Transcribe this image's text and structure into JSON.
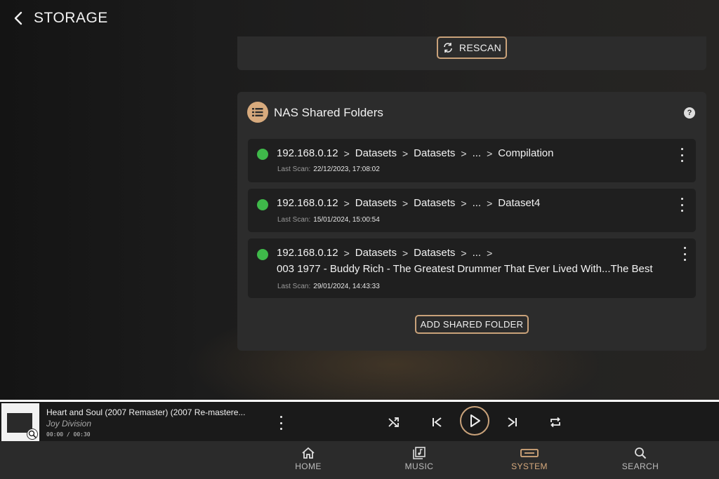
{
  "header": {
    "title": "STORAGE"
  },
  "rescan": {
    "label": "RESCAN"
  },
  "nas": {
    "title": "NAS Shared Folders",
    "help": "?",
    "folders": [
      {
        "ip": "192.168.0.12",
        "seg1": "Datasets",
        "seg2": "Datasets",
        "ellipsis": "...",
        "leaf": "Compilation",
        "scan_label": "Last Scan:",
        "scan_time": "22/12/2023, 17:08:02",
        "status": "online"
      },
      {
        "ip": "192.168.0.12",
        "seg1": "Datasets",
        "seg2": "Datasets",
        "ellipsis": "...",
        "leaf": "Dataset4",
        "scan_label": "Last Scan:",
        "scan_time": "15/01/2024, 15:00:54",
        "status": "online"
      },
      {
        "ip": "192.168.0.12",
        "seg1": "Datasets",
        "seg2": "Datasets",
        "ellipsis": "...",
        "leaf": "003 1977 - Buddy Rich - The Greatest Drummer That Ever Lived With...The Best",
        "scan_label": "Last Scan:",
        "scan_time": "29/01/2024, 14:43:33",
        "status": "online"
      }
    ],
    "add_label": "ADD SHARED FOLDER"
  },
  "player": {
    "title": "Heart and Soul (2007 Remaster) (2007 Re-mastere...",
    "artist": "Joy Division",
    "time": "00:00 / 00:30"
  },
  "nav": {
    "items": [
      {
        "label": "HOME",
        "icon": "home-icon"
      },
      {
        "label": "MUSIC",
        "icon": "music-library-icon"
      },
      {
        "label": "SYSTEM",
        "icon": "system-icon",
        "active": true
      },
      {
        "label": "SEARCH",
        "icon": "search-icon"
      }
    ]
  },
  "colors": {
    "accent": "#d7aa7d",
    "status_online": "#3fb94a",
    "card": "#2c2c2c"
  }
}
